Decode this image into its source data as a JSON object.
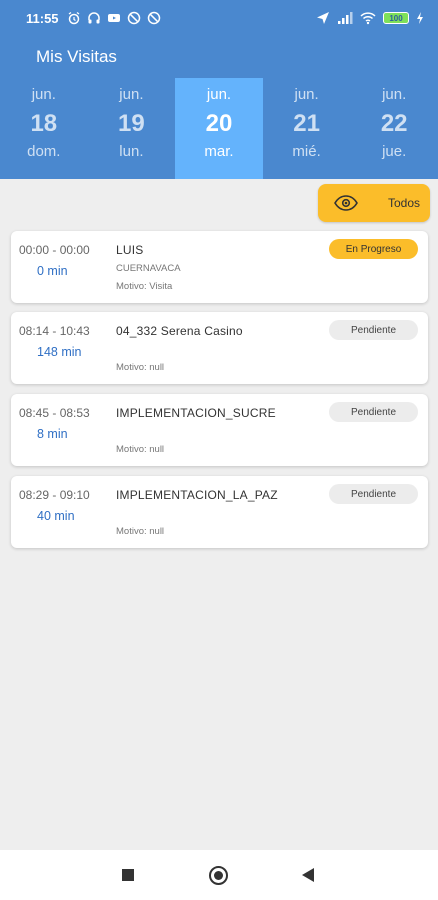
{
  "status": {
    "time": "11:55",
    "battery": "100"
  },
  "app": {
    "title": "Mis Visitas"
  },
  "days": [
    {
      "month": "jun.",
      "day": "18",
      "weekday": "dom.",
      "selected": false
    },
    {
      "month": "jun.",
      "day": "19",
      "weekday": "lun.",
      "selected": false
    },
    {
      "month": "jun.",
      "day": "20",
      "weekday": "mar.",
      "selected": true
    },
    {
      "month": "jun.",
      "day": "21",
      "weekday": "mié.",
      "selected": false
    },
    {
      "month": "jun.",
      "day": "22",
      "weekday": "jue.",
      "selected": false
    }
  ],
  "filter": {
    "label": "Todos",
    "icon": "eye-icon"
  },
  "visits": [
    {
      "time": "00:00 - 00:00",
      "duration": "0 min",
      "title": "LUIS",
      "subtitle": "CUERNAVACA",
      "motivo": "Motivo: Visita",
      "status": "En Progreso"
    },
    {
      "time": "08:14 - 10:43",
      "duration": "148 min",
      "title": "04_332  Serena Casino",
      "subtitle": "",
      "motivo": "Motivo: null",
      "status": "Pendiente"
    },
    {
      "time": "08:45 - 08:53",
      "duration": "8 min",
      "title": "IMPLEMENTACION_SUCRE",
      "subtitle": "",
      "motivo": "Motivo: null",
      "status": "Pendiente"
    },
    {
      "time": "08:29 - 09:10",
      "duration": "40 min",
      "title": "IMPLEMENTACION_LA_PAZ",
      "subtitle": "",
      "motivo": "Motivo: null",
      "status": "Pendiente"
    }
  ],
  "colors": {
    "primary": "#4a88cf",
    "selected_day": "#64b3fc",
    "accent": "#fbbd2a",
    "duration": "#2f6fc4"
  }
}
